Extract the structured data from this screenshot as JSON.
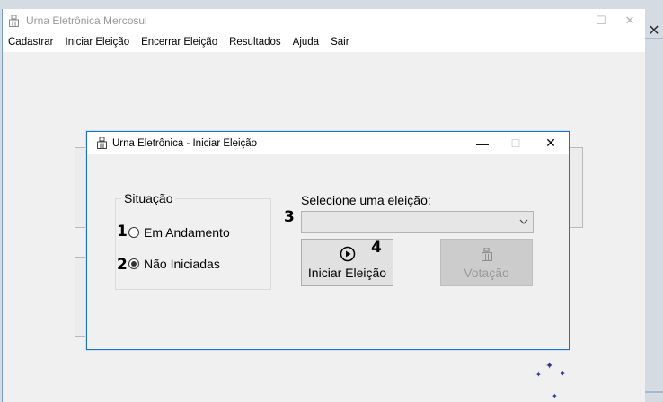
{
  "main_window": {
    "title": "Urna Eletrônica Mercosul",
    "menu": [
      "Cadastrar",
      "Iniciar Eleição",
      "Encerrar Eleição",
      "Resultados",
      "Ajuda",
      "Sair"
    ]
  },
  "dialog": {
    "title": "Urna Eletrônica - Iniciar Eleição",
    "group_title": "Situação",
    "radio_em_andamento": "Em Andamento",
    "radio_nao_iniciadas": "Não Iniciadas",
    "selected_radio": "Não Iniciadas",
    "select_label": "Selecione uma eleição:",
    "select_value": "",
    "start_button": "Iniciar Eleição",
    "vote_button": "Votação"
  },
  "annotations": {
    "n1": "1",
    "n2": "2",
    "n3": "3",
    "n4": "4"
  },
  "icons": {
    "app": "ballot-box-icon",
    "start": "play-circle-icon",
    "vote": "ballot-box-icon",
    "dropdown": "chevron-down-icon"
  },
  "colors": {
    "accent_border": "#1a73c8",
    "disabled_button": "#cccccc",
    "sparkle": "#2b3a8a"
  }
}
